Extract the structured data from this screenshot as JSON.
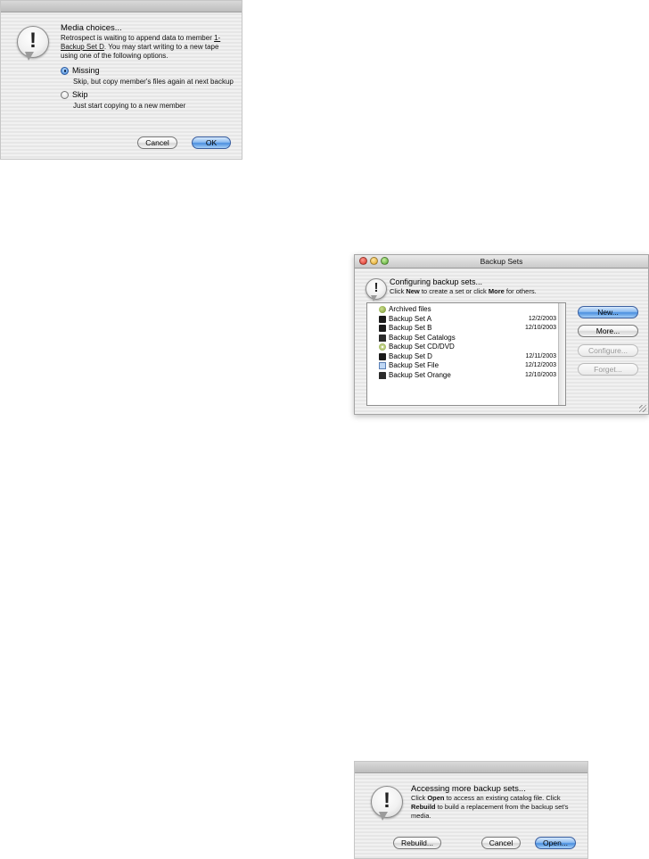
{
  "media_dialog": {
    "title": "Media choices...",
    "message_pre": "Retrospect is waiting to append data to member ",
    "message_member_line1": "1-",
    "message_member_line2": "Backup Set D",
    "message_post_line2": ". You may start writing to a new tape",
    "message_line3": "using one of the following options.",
    "options": [
      {
        "label": "Missing",
        "description": "Skip, but copy member's files again at next backup",
        "checked": true
      },
      {
        "label": "Skip",
        "description": "Just start copying to a new member",
        "checked": false
      }
    ],
    "cancel_label": "Cancel",
    "ok_label": "OK"
  },
  "backup_sets_window": {
    "title": "Backup Sets",
    "heading": "Configuring backup sets...",
    "instruction_pre": "Click ",
    "instruction_new": "New",
    "instruction_mid": " to create a set or click ",
    "instruction_more": "More",
    "instruction_post": " for others.",
    "items": [
      {
        "name": "Archived files",
        "date": "",
        "icon": "archive-icon"
      },
      {
        "name": "Backup Set A",
        "date": "12/2/2003",
        "icon": "tape-icon"
      },
      {
        "name": "Backup Set B",
        "date": "12/10/2003",
        "icon": "tape-icon"
      },
      {
        "name": "Backup Set Catalogs",
        "date": "",
        "icon": "disk-icon"
      },
      {
        "name": "Backup Set CD/DVD",
        "date": "",
        "icon": "cd-icon"
      },
      {
        "name": "Backup Set D",
        "date": "12/11/2003",
        "icon": "tape-icon"
      },
      {
        "name": "Backup Set File",
        "date": "12/12/2003",
        "icon": "file-icon"
      },
      {
        "name": "Backup Set Orange",
        "date": "12/10/2003",
        "icon": "disk-icon"
      }
    ],
    "buttons": {
      "new": "New...",
      "more": "More...",
      "configure": "Configure...",
      "forget": "Forget..."
    }
  },
  "more_sets_dialog": {
    "title": "Accessing more backup sets...",
    "line1_pre": "Click ",
    "line1_open": "Open",
    "line1_post": " to access an existing catalog file. Click",
    "line2_rebuild": "Rebuild",
    "line2_post": " to build a replacement from the backup set's",
    "line3": "media.",
    "rebuild_label": "Rebuild...",
    "cancel_label": "Cancel",
    "open_label": "Open..."
  }
}
